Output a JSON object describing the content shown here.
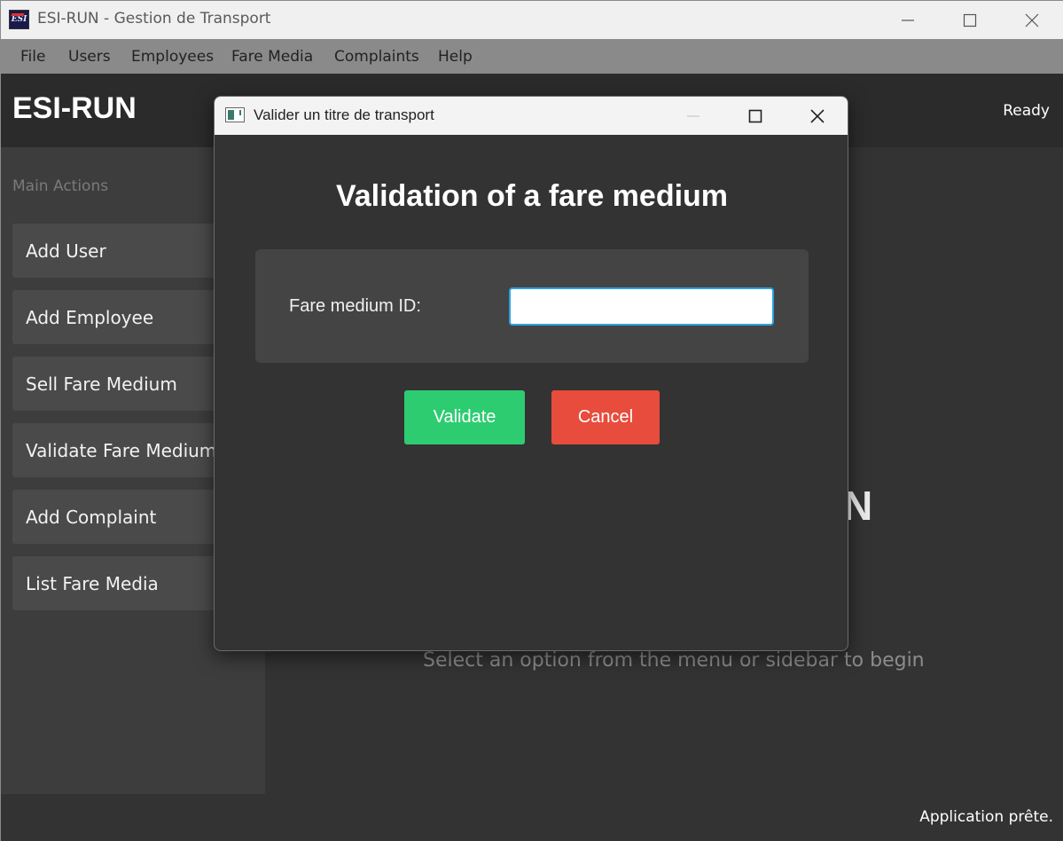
{
  "window": {
    "title": "ESI-RUN - Gestion de Transport",
    "icon_text": "ESI"
  },
  "menubar": {
    "items": [
      "File",
      "Users",
      "Employees",
      "Fare Media",
      "Complaints",
      "Help"
    ]
  },
  "header": {
    "brand": "ESI-RUN",
    "status": "Ready"
  },
  "sidebar": {
    "caption": "Main Actions",
    "buttons": [
      "Add User",
      "Add Employee",
      "Sell Fare Medium",
      "Validate Fare Medium",
      "Add Complaint",
      "List Fare Media"
    ]
  },
  "main": {
    "welcome_fragment": "N",
    "hint": "Select an option from the menu or sidebar to begin"
  },
  "statusbar": {
    "text": "Application prête."
  },
  "dialog": {
    "title": "Valider un titre de transport",
    "heading": "Validation of a fare medium",
    "field_label": "Fare medium ID:",
    "field_value": "",
    "validate_label": "Validate",
    "cancel_label": "Cancel"
  },
  "colors": {
    "accent_green": "#2ecc71",
    "accent_red": "#e74c3c",
    "input_focus": "#2aa3e0"
  }
}
